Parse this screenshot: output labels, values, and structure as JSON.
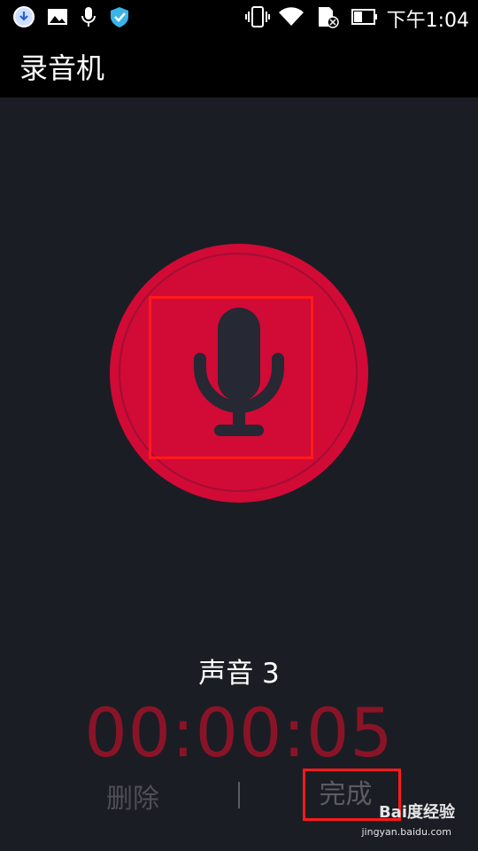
{
  "status_bar": {
    "time": "下午1:04",
    "icons": [
      "download-icon",
      "image-icon",
      "microphone-icon",
      "shield-icon",
      "vibrate-icon",
      "wifi-icon",
      "sd-card-icon",
      "battery-icon"
    ]
  },
  "app_bar": {
    "title": "录音机"
  },
  "recorder": {
    "record_button_icon": "microphone-icon",
    "recording_name": "声音 3",
    "elapsed_time": "00:00:05",
    "delete_label": "删除",
    "done_label": "完成"
  },
  "watermark": {
    "text": "Bai度经验",
    "sub": "jingyan.baidu.com"
  },
  "colors": {
    "background": "#1b1d24",
    "record_red": "#d20a36",
    "timer_red": "#8a1427",
    "highlight": "#ff1a1a"
  }
}
